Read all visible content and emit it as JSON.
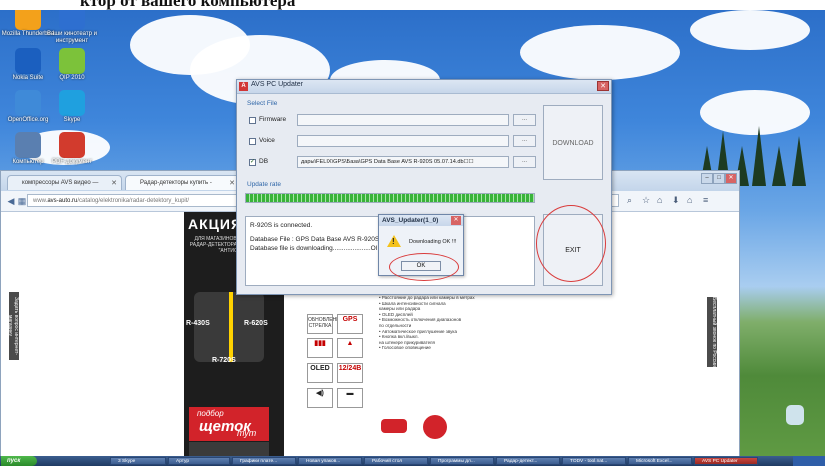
{
  "page_heading": "ктор от вашего компьютера",
  "desktop": {
    "icons": [
      {
        "label": "Mozilla Thunderbird",
        "color": "#f3a11b"
      },
      {
        "label": "Ваши кинотеатр и инструмент",
        "color": "#2e6fd0"
      },
      {
        "label": "Nokia Suite",
        "color": "#1b5fbf"
      },
      {
        "label": "QIP 2010",
        "color": "#7cc23a"
      },
      {
        "label": "OpenOffice.org",
        "color": "#3f8ad8"
      },
      {
        "label": "Skype",
        "color": "#1fa0df"
      },
      {
        "label": "Компьютер",
        "color": "#5a7fb0"
      },
      {
        "label": "PDF-документ",
        "color": "#d23b2d"
      }
    ]
  },
  "browser": {
    "tabs": [
      {
        "label": "компрессоры AVS видео — ",
        "active": false
      },
      {
        "label": "Радар-детекторы купить - ",
        "active": true
      }
    ],
    "url_prefix": "www.",
    "url_domain": "avs-auto.ru",
    "url_path": "/catalog/elektronika/radar-detektory_kupit/"
  },
  "site": {
    "left_tab": "Задать вопрос интернет-магазину",
    "right_tab": "Бесплатный звонок по России",
    "banner_title": "АКЦИЯ",
    "banner_sub": "ДЛЯ МАГАЗИНОВ ПРИ ПОКУПКЕ РАДАР-ДЕТЕКТОРА AVS В ПОДАРОК \"АНТИСКОЛ\"",
    "models": [
      "R-430S",
      "R-620S",
      "R-720S"
    ],
    "brush_line1": "подбор",
    "brush_line2": "щеток",
    "brush_line3": "тут",
    "gps_badge": "GPS",
    "oled_badge": "OLED",
    "volt_badge": "12/24В",
    "feature_block_label": "ОБНОВЛЕНИЕ СТРЕЛКА",
    "bullets": [
      "на расстоянии до 1000 метров",
      "• Обнаружение сигналов лазера",
      "на 360 градусов",
      "• GPS база радаров и камер",
      "•Установка ограничения скорости",
      "• Расстояние до радара или камеры в метрах",
      "• Шкала интенсивности сигнала",
      "камеры или радара",
      "• OLED дисплей",
      "• Возможность отключения диапазонов",
      "по отдельности",
      "• Автоматическое приглушение звука",
      "• Кнопка вкл./выкл.",
      "на штекере прикуривателя",
      "• Голосовое оповещение"
    ]
  },
  "updater": {
    "title": "AVS PC Updater",
    "select_file": "Select File",
    "firmware_label": "Firmware",
    "voice_label": "Voice",
    "db_label": "DB",
    "firmware_path": "",
    "voice_path": "",
    "db_path": "дары\\FELIX\\GPS\\База\\GPS Data Base AVS R-920S 05.07.14.db☐☐",
    "browse_label": "...",
    "download_label": "DOWNLOAD",
    "update_rate_label": "Update rate",
    "progress_value": 1.0,
    "log_line1": "R-920S is connected.",
    "log_line2": "Database File : GPS Data Base AVS R-920S 0",
    "log_line3": "Database file is downloading.....................Ol",
    "exit_label": "EXIT"
  },
  "msgbox": {
    "title": "AVS_Updater(1_0)",
    "message": "Downloading OK !!!",
    "ok_label": "OK"
  },
  "taskbar": {
    "start_label": "пуск",
    "tasks": [
      {
        "label": "3 Skype"
      },
      {
        "label": "Артур"
      },
      {
        "label": "Графики плате..."
      },
      {
        "label": "Новая упаков..."
      },
      {
        "label": "Рабочий стол"
      },
      {
        "label": "Программы дл..."
      },
      {
        "label": "Радар-детект..."
      },
      {
        "label": "TODV - tool.nat..."
      },
      {
        "label": "Microsoft Excel..."
      },
      {
        "label": "AVS PC Updater",
        "active": true
      }
    ]
  },
  "colors": {
    "accent": "#2f66a8",
    "progress": "#39b33a",
    "highlight_ring": "#d93b3b"
  }
}
